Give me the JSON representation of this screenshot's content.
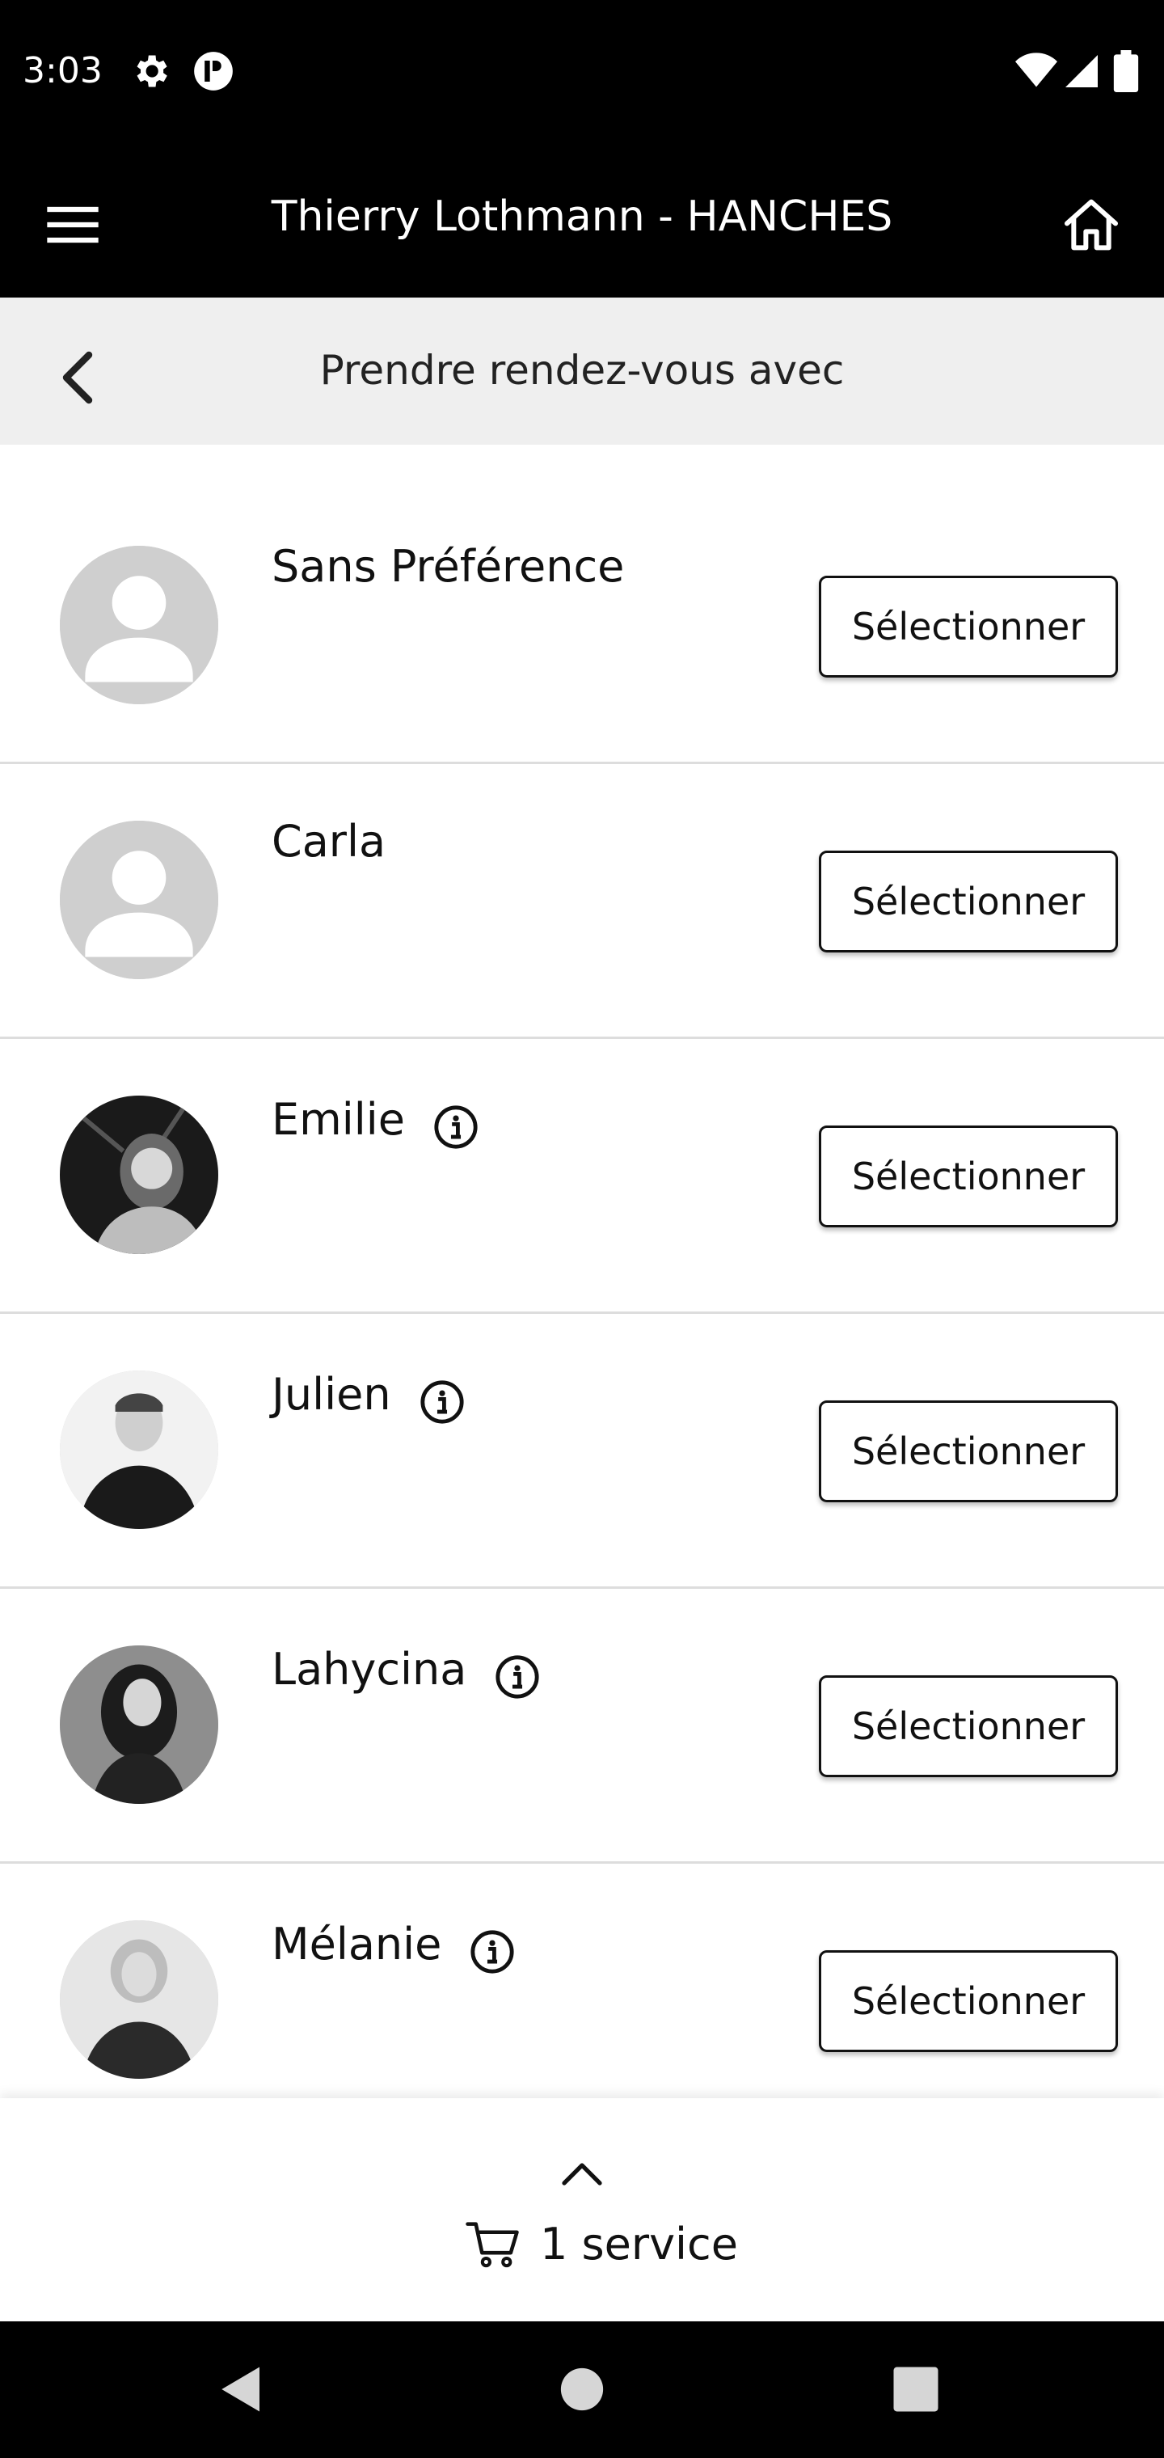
{
  "status_bar": {
    "time": "3:03",
    "icons": [
      "gear-icon",
      "app-logo-icon",
      "wifi-icon",
      "signal-icon",
      "battery-icon"
    ]
  },
  "app_bar": {
    "title": "Thierry Lothmann - HANCHES",
    "menu_icon": "hamburger-icon",
    "home_icon": "home-icon"
  },
  "sub_header": {
    "title": "Prendre rendez-vous avec",
    "back_icon": "chevron-left-icon"
  },
  "staff": [
    {
      "name": "Sans Préférence",
      "button": "Sélectionner",
      "avatar": "placeholder",
      "info": false
    },
    {
      "name": "Carla",
      "button": "Sélectionner",
      "avatar": "placeholder",
      "info": false
    },
    {
      "name": "Emilie",
      "button": "Sélectionner",
      "avatar": "photo",
      "info": true
    },
    {
      "name": "Julien",
      "button": "Sélectionner",
      "avatar": "photo",
      "info": true
    },
    {
      "name": "Lahycina",
      "button": "Sélectionner",
      "avatar": "photo",
      "info": true
    },
    {
      "name": "Mélanie",
      "button": "Sélectionner",
      "avatar": "photo",
      "info": true
    }
  ],
  "cart": {
    "label": "1 service",
    "icon": "cart-icon",
    "expand_icon": "chevron-up-icon"
  },
  "nav_bar": {
    "icons": [
      "back-triangle-icon",
      "home-circle-icon",
      "recents-square-icon"
    ]
  },
  "colors": {
    "bar": "#000000",
    "sub_header_bg": "#efefef",
    "divider": "#dddddd",
    "placeholder_avatar": "#cfcfcf"
  }
}
